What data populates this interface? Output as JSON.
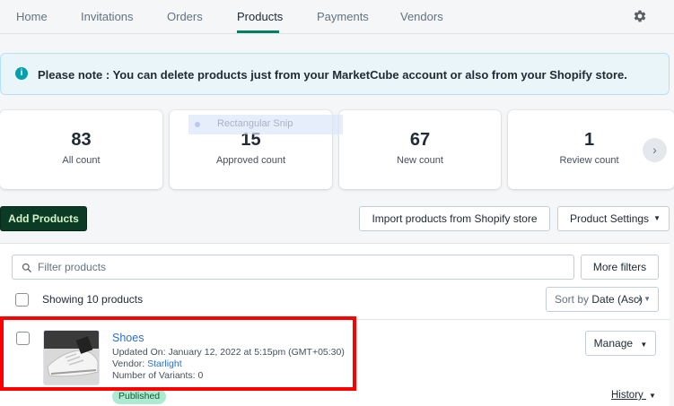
{
  "nav": {
    "tabs": [
      {
        "label": "Home"
      },
      {
        "label": "Invitations"
      },
      {
        "label": "Orders"
      },
      {
        "label": "Products"
      },
      {
        "label": "Payments"
      },
      {
        "label": "Vendors"
      }
    ],
    "active_tab": "Products",
    "settings_icon": "gear-icon"
  },
  "banner": {
    "icon": "info-icon",
    "text": "Please note : You can delete products just from your MarketCube account or also from your Shopify store."
  },
  "stats": [
    {
      "value": "83",
      "label": "All count"
    },
    {
      "value": "15",
      "label": "Approved count"
    },
    {
      "value": "67",
      "label": "New count"
    },
    {
      "value": "1",
      "label": "Review count"
    }
  ],
  "snip_overlay": {
    "text": "Rectangular Snip"
  },
  "actions": {
    "add_products": "Add Products",
    "import_shopify": "Import products from Shopify store",
    "product_settings": "Product Settings"
  },
  "filters": {
    "search_placeholder": "Filter products",
    "more_filters": "More filters",
    "showing_text": "Showing 10 products",
    "sort_label": "Sort by",
    "sort_value": "Date (Asc)"
  },
  "products": [
    {
      "name": "Shoes",
      "updated_on": "Updated On: January 12, 2022 at 5:15pm (GMT+05:30)",
      "vendor_label": "Vendor: ",
      "vendor": "Starlight",
      "variants": "Number of Variants: 0",
      "status": "Published",
      "manage_label": "Manage",
      "history_label": "History"
    }
  ],
  "colors": {
    "primary_button": "#0b3a25",
    "active_tab_underline": "#008060",
    "link": "#2c6ecb",
    "published_badge": "#aee9d1",
    "highlight_box": "#ff0000",
    "banner_bg": "#eaf5fa"
  }
}
